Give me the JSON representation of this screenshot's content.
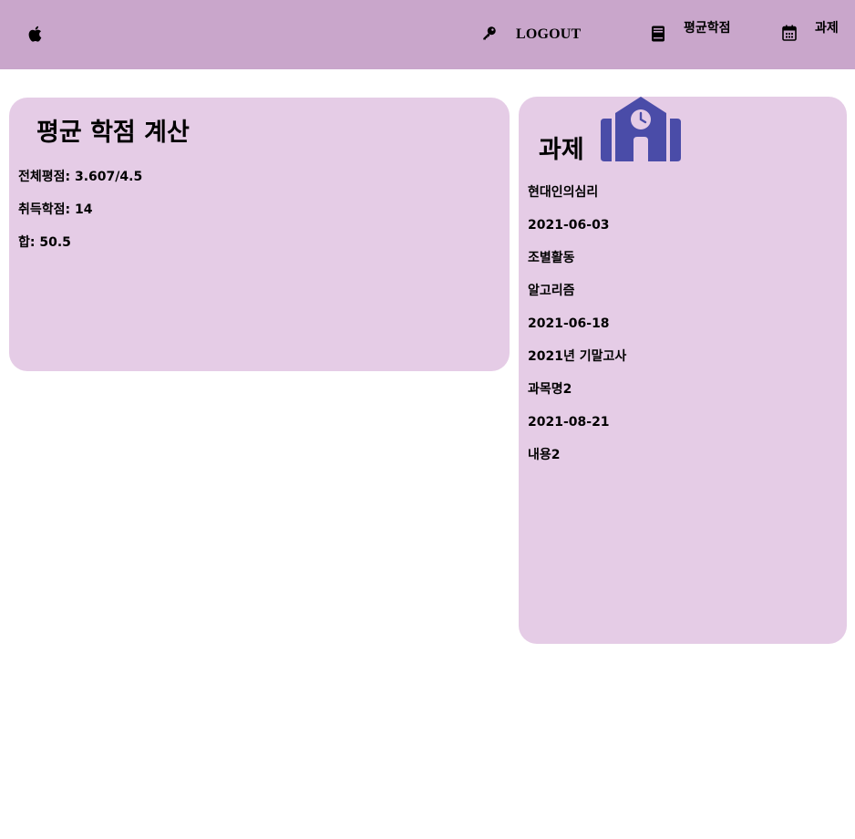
{
  "navbar": {
    "background": "#c9a6cb",
    "logo_icon": "apple-icon",
    "logout": {
      "icon": "key-icon",
      "label": "LOGOUT"
    },
    "gpa": {
      "icon": "book-icon",
      "label": "평균학점"
    },
    "tasks": {
      "icon": "calendar-icon",
      "label": "과제"
    }
  },
  "gpa_card": {
    "title": "평균 학점 계산",
    "rows": [
      "전체평점: 3.607/4.5",
      "취득학점: 14",
      "합: 50.5"
    ]
  },
  "tasks_card": {
    "title": "과제",
    "header_icon": "school-clock-icon",
    "accent": "#4a4ca8",
    "items": [
      "현대인의심리",
      "2021-06-03",
      "조별활동",
      "알고리즘",
      "2021-06-18",
      "2021년 기말고사",
      "과목명2",
      "2021-08-21",
      "내용2"
    ]
  },
  "colors": {
    "card_background": "#e5cce6",
    "page_background": "#ffffff"
  }
}
